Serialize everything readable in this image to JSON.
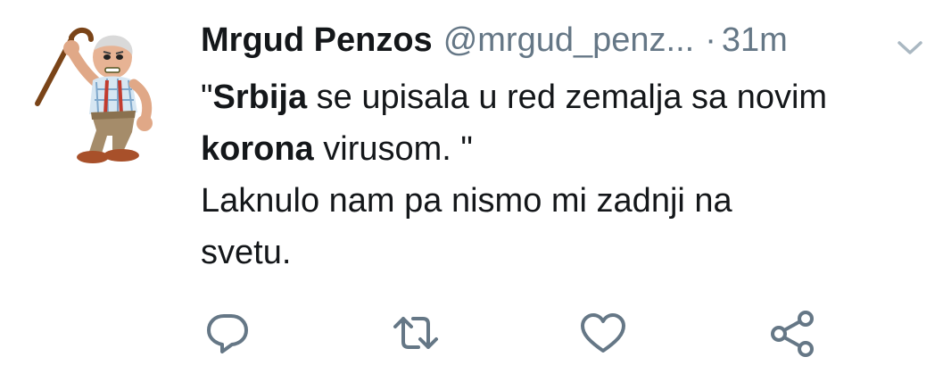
{
  "tweet": {
    "author_name": "Mrgud Penzos",
    "handle": "@mrgud_penz...",
    "separator": "·",
    "time": "31m",
    "text": {
      "line1_open_quote": "\"",
      "line1_bold": "Srbija",
      "line1_rest": " se upisala u red zemalja sa novim",
      "line2_bold": "korona",
      "line2_rest": " virusom. \"",
      "line3": "Laknulo nam pa nismo mi zadnji na",
      "line4": "svetu."
    }
  },
  "icons": {
    "menu": "chevron-down-icon",
    "reply": "reply-bubble-icon",
    "retweet": "retweet-icon",
    "like": "heart-icon",
    "share": "share-icon"
  },
  "colors": {
    "text": "#14171a",
    "secondary": "#657786",
    "icon": "#657786",
    "background": "#ffffff"
  }
}
